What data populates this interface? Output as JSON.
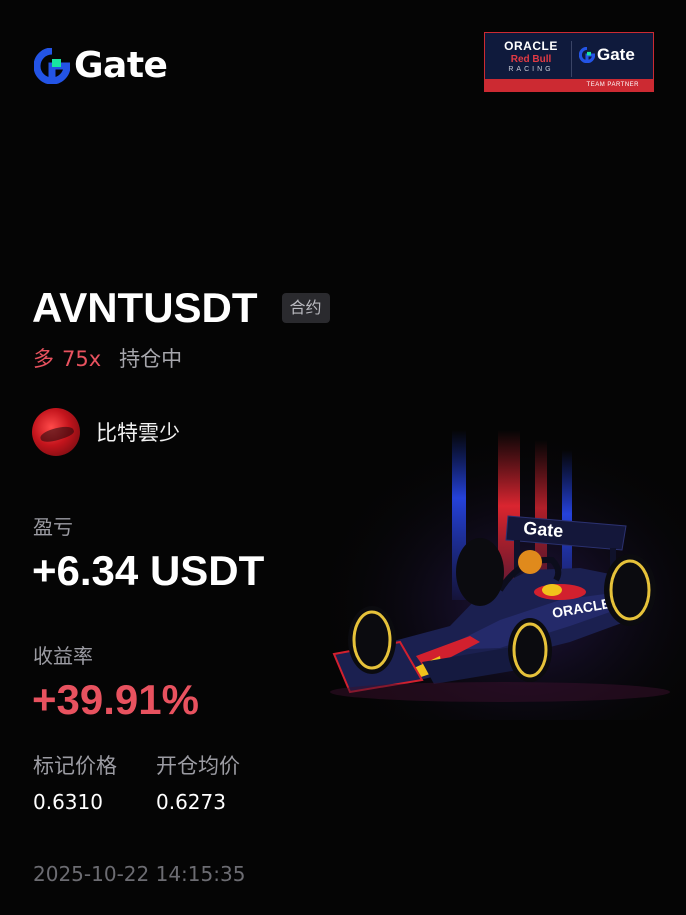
{
  "brand": {
    "name": "Gate"
  },
  "partner": {
    "oracle": "ORACLE",
    "redbull": "Red Bull",
    "racing": "RACING",
    "gate": "Gate",
    "team_partner": "TEAM PARTNER"
  },
  "position": {
    "symbol": "AVNTUSDT",
    "type_tag": "合约",
    "direction": "多",
    "leverage": "75x",
    "status": "持仓中"
  },
  "user": {
    "name": "比特雲少"
  },
  "pnl": {
    "label": "盈亏",
    "value": "+6.34 USDT"
  },
  "roi": {
    "label": "收益率",
    "value": "+39.91%"
  },
  "prices": {
    "mark_label": "标记价格",
    "mark_value": "0.6310",
    "entry_label": "开仓均价",
    "entry_value": "0.6273"
  },
  "timestamp": "2025-10-22 14:15:35",
  "car": {
    "wing_text": "Gate"
  },
  "colors": {
    "background": "#050505",
    "accent_red": "#e8525f",
    "brand_blue": "#2354e6",
    "brand_green": "#17e6a1"
  }
}
